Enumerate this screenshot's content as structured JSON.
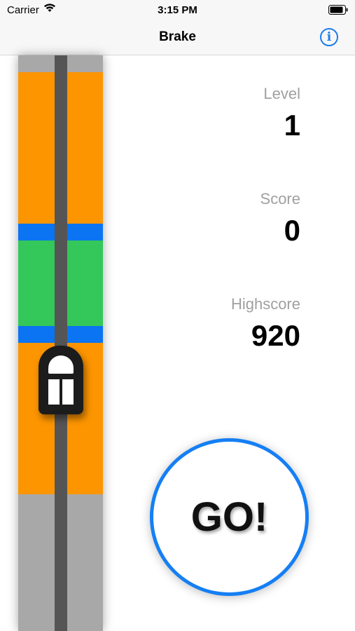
{
  "status_bar": {
    "carrier": "Carrier",
    "time": "3:15 PM"
  },
  "nav": {
    "title": "Brake",
    "info_icon": "info-circle-icon",
    "accent_color": "#1b7cf0"
  },
  "track": {
    "segments": [
      "gray",
      "orange",
      "blue",
      "green",
      "blue",
      "orange",
      "gray"
    ],
    "colors": {
      "orange": "#fd9500",
      "blue": "#0b74f2",
      "green": "#34c759",
      "gray": "#a8a8a8",
      "rail": "#555555"
    }
  },
  "stats": {
    "level_label": "Level",
    "level_value": "1",
    "score_label": "Score",
    "score_value": "0",
    "highscore_label": "Highscore",
    "highscore_value": "920"
  },
  "go_button": {
    "label": "GO!",
    "ring_color": "#157ff4"
  }
}
